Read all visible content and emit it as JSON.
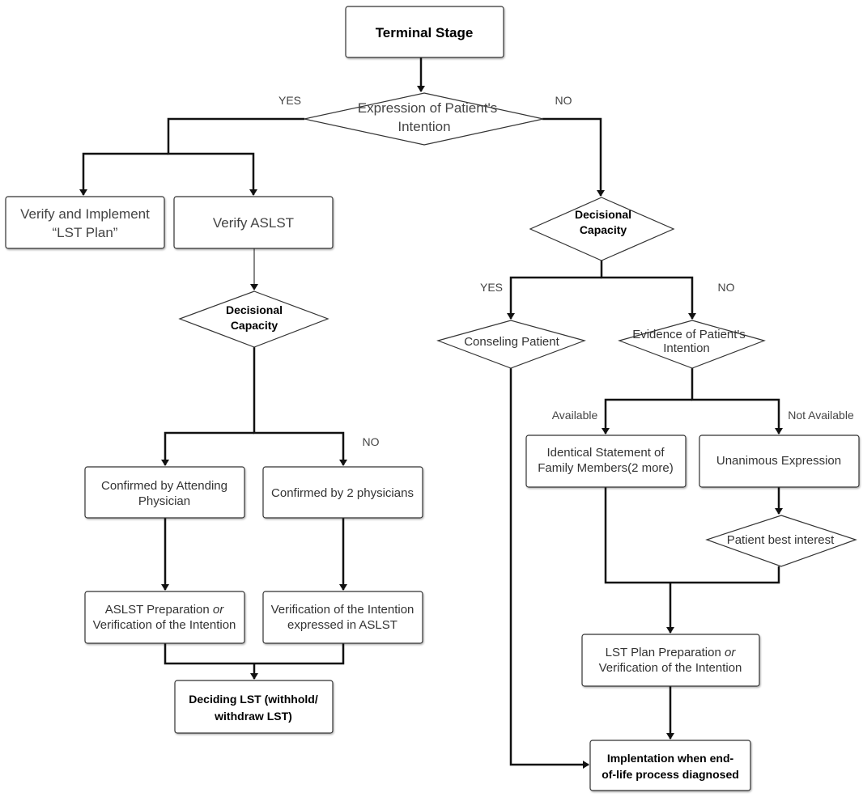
{
  "nodes": {
    "terminal_stage": "Terminal Stage",
    "expression": [
      "Expression of Patient's",
      "Intention"
    ],
    "verify_implement": [
      "Verify and Implement",
      "“LST Plan”"
    ],
    "verify_aslst": "Verify ASLST",
    "decisional_left": [
      "Decisional",
      "Capacity"
    ],
    "confirmed_attending": [
      "Confirmed by Attending",
      "Physician"
    ],
    "confirmed_two": "Confirmed by 2 physicians",
    "aslst_prep": [
      "ASLST Preparation ",
      "or",
      "Verification of the Intention"
    ],
    "verification_expressed": [
      "Verification of the Intention",
      "expressed in ASLST"
    ],
    "deciding_lst": [
      "Deciding LST (withhold/",
      "withdraw LST)"
    ],
    "decisional_right": [
      "Decisional",
      "Capacity"
    ],
    "conseling": "Conseling Patient",
    "evidence": [
      "Evidence of Patient's",
      "Intention"
    ],
    "identical": [
      "Identical Statement of",
      "Family Members(2 more)"
    ],
    "unanimous": "Unanimous Expression",
    "best_interest": "Patient best interest",
    "lst_plan": [
      "LST Plan Preparation ",
      "or",
      "Verification of the Intention"
    ],
    "implementation": [
      "Implentation when end-",
      "of-life process diagnosed"
    ]
  },
  "labels": {
    "yes_top": "YES",
    "no_top": "NO",
    "no_left": "NO",
    "yes_right": "YES",
    "no_right": "NO",
    "available": "Available",
    "not_available": "Not Available"
  }
}
